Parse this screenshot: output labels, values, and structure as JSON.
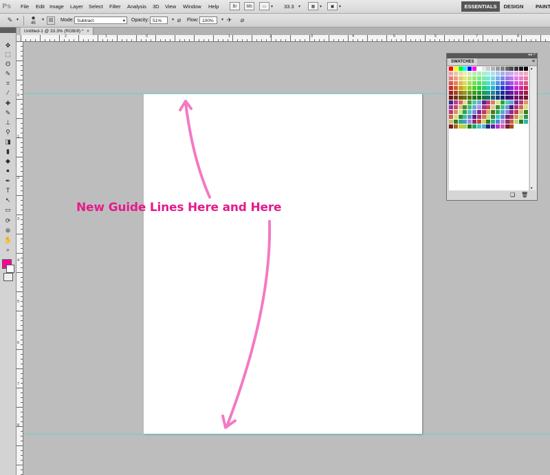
{
  "app": {
    "logo": "Ps"
  },
  "menubar": {
    "items": [
      "File",
      "Edit",
      "Image",
      "Layer",
      "Select",
      "Filter",
      "Analysis",
      "3D",
      "View",
      "Window",
      "Help"
    ],
    "bridge_icon": "Br",
    "minibridge_icon": "Mb",
    "zoom": "33.3",
    "workspaces": [
      "ESSENTIALS",
      "DESIGN",
      "PAINTI"
    ]
  },
  "options": {
    "brush_size": "45",
    "mode_label": "Mode:",
    "mode_value": "Subtract",
    "opacity_label": "Opacity:",
    "opacity_value": "51%",
    "flow_label": "Flow:",
    "flow_value": "100%"
  },
  "document": {
    "tab_title": "Untitled-1 @ 33.3% (RGB/8) *",
    "close": "×"
  },
  "ruler": {
    "h_labels": [
      "2",
      "1",
      "0",
      "1",
      "2",
      "3",
      "4",
      "5",
      "6",
      "7",
      "8"
    ],
    "v_labels": [
      "0",
      "1",
      "2",
      "3",
      "4",
      "5",
      "6",
      "7",
      "8"
    ]
  },
  "swatches": {
    "tab": "SWATCHES",
    "menu": "≡",
    "collapse": "◂◂ ×"
  },
  "annotation": {
    "text": "New Guide Lines Here and Here",
    "color": "#e41b8c",
    "arrow_color": "#f37ac4"
  },
  "colors": {
    "foreground": "#ff0099",
    "background": "#ffffff",
    "guide": "#57d2d2",
    "canvas_bg": "#bdbdbd"
  },
  "icons": {
    "tools": [
      "move-icon",
      "marquee-icon",
      "lasso-icon",
      "quick-select-icon",
      "crop-icon",
      "eyedropper-icon",
      "healing-icon",
      "brush-icon",
      "clone-stamp-icon",
      "history-brush-icon",
      "eraser-icon",
      "gradient-icon",
      "blur-icon",
      "dodge-icon",
      "pen-icon",
      "type-icon",
      "path-select-icon",
      "shape-icon",
      "3d-rotate-icon",
      "3d-orbit-icon",
      "hand-icon",
      "zoom-icon"
    ]
  }
}
